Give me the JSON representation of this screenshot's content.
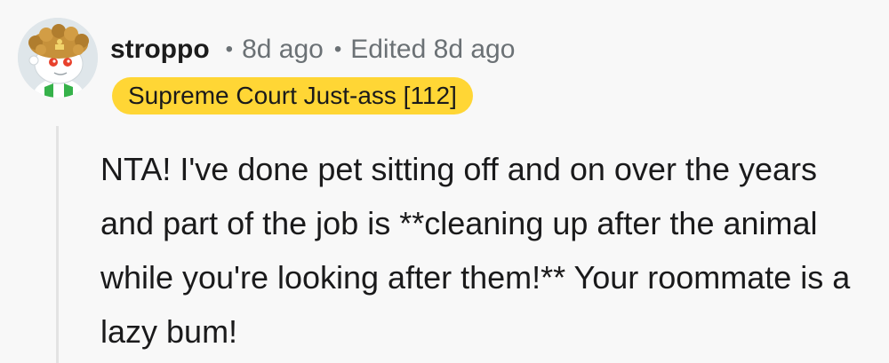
{
  "comment": {
    "username": "stroppo",
    "posted_ago": "8d ago",
    "edited": "Edited 8d ago",
    "separator": "•",
    "flair": "Supreme Court Just-ass [112]",
    "body": "NTA! I've done pet sitting off and on over the years and part of the job is **cleaning up after the animal while you're looking after them!** Your roommate is a lazy bum!",
    "avatar_icon": "snoo-avatar-icon"
  },
  "colors": {
    "background": "#f8f8f8",
    "flair_bg": "#ffd635",
    "meta_text": "#6b7175",
    "thread_line": "#e3e3e3"
  }
}
